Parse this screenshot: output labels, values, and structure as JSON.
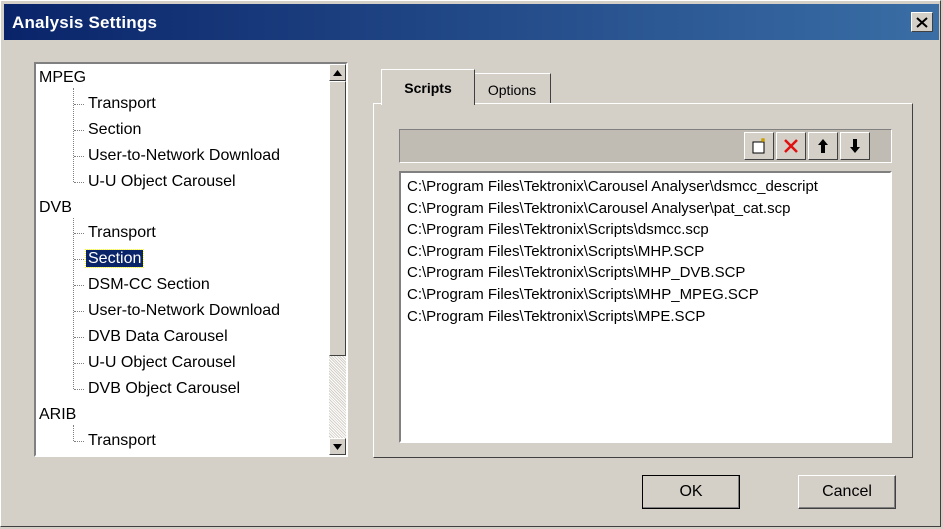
{
  "window": {
    "title": "Analysis Settings",
    "close_icon": "close-icon"
  },
  "tree": {
    "groups": [
      {
        "label": "MPEG",
        "children": [
          "Transport",
          "Section",
          "User-to-Network Download",
          "U-U Object Carousel"
        ]
      },
      {
        "label": "DVB",
        "children": [
          "Transport",
          "Section",
          "DSM-CC Section",
          "User-to-Network Download",
          "DVB Data Carousel",
          "U-U Object Carousel",
          "DVB Object Carousel"
        ]
      },
      {
        "label": "ARIB",
        "children": [
          "Transport"
        ]
      }
    ],
    "selected": {
      "group": "DVB",
      "item": "Section"
    }
  },
  "tabs": [
    {
      "label": "Scripts",
      "active": true
    },
    {
      "label": "Options",
      "active": false
    }
  ],
  "scripts_toolbar": {
    "buttons": [
      "new-script-icon",
      "delete-icon",
      "arrow-up-icon",
      "arrow-down-icon"
    ]
  },
  "scripts": [
    "C:\\Program Files\\Tektronix\\Carousel Analyser\\dsmcc_descript",
    "C:\\Program Files\\Tektronix\\Carousel Analyser\\pat_cat.scp",
    "C:\\Program Files\\Tektronix\\Scripts\\dsmcc.scp",
    "C:\\Program Files\\Tektronix\\Scripts\\MHP.SCP",
    "C:\\Program Files\\Tektronix\\Scripts\\MHP_DVB.SCP",
    "C:\\Program Files\\Tektronix\\Scripts\\MHP_MPEG.SCP",
    "C:\\Program Files\\Tektronix\\Scripts\\MPE.SCP"
  ],
  "buttons": {
    "ok": "OK",
    "cancel": "Cancel"
  },
  "colors": {
    "titlebar": "#0a246a",
    "selection": "#0a246a",
    "face": "#d4d0c8",
    "delete_icon": "#e01010"
  }
}
